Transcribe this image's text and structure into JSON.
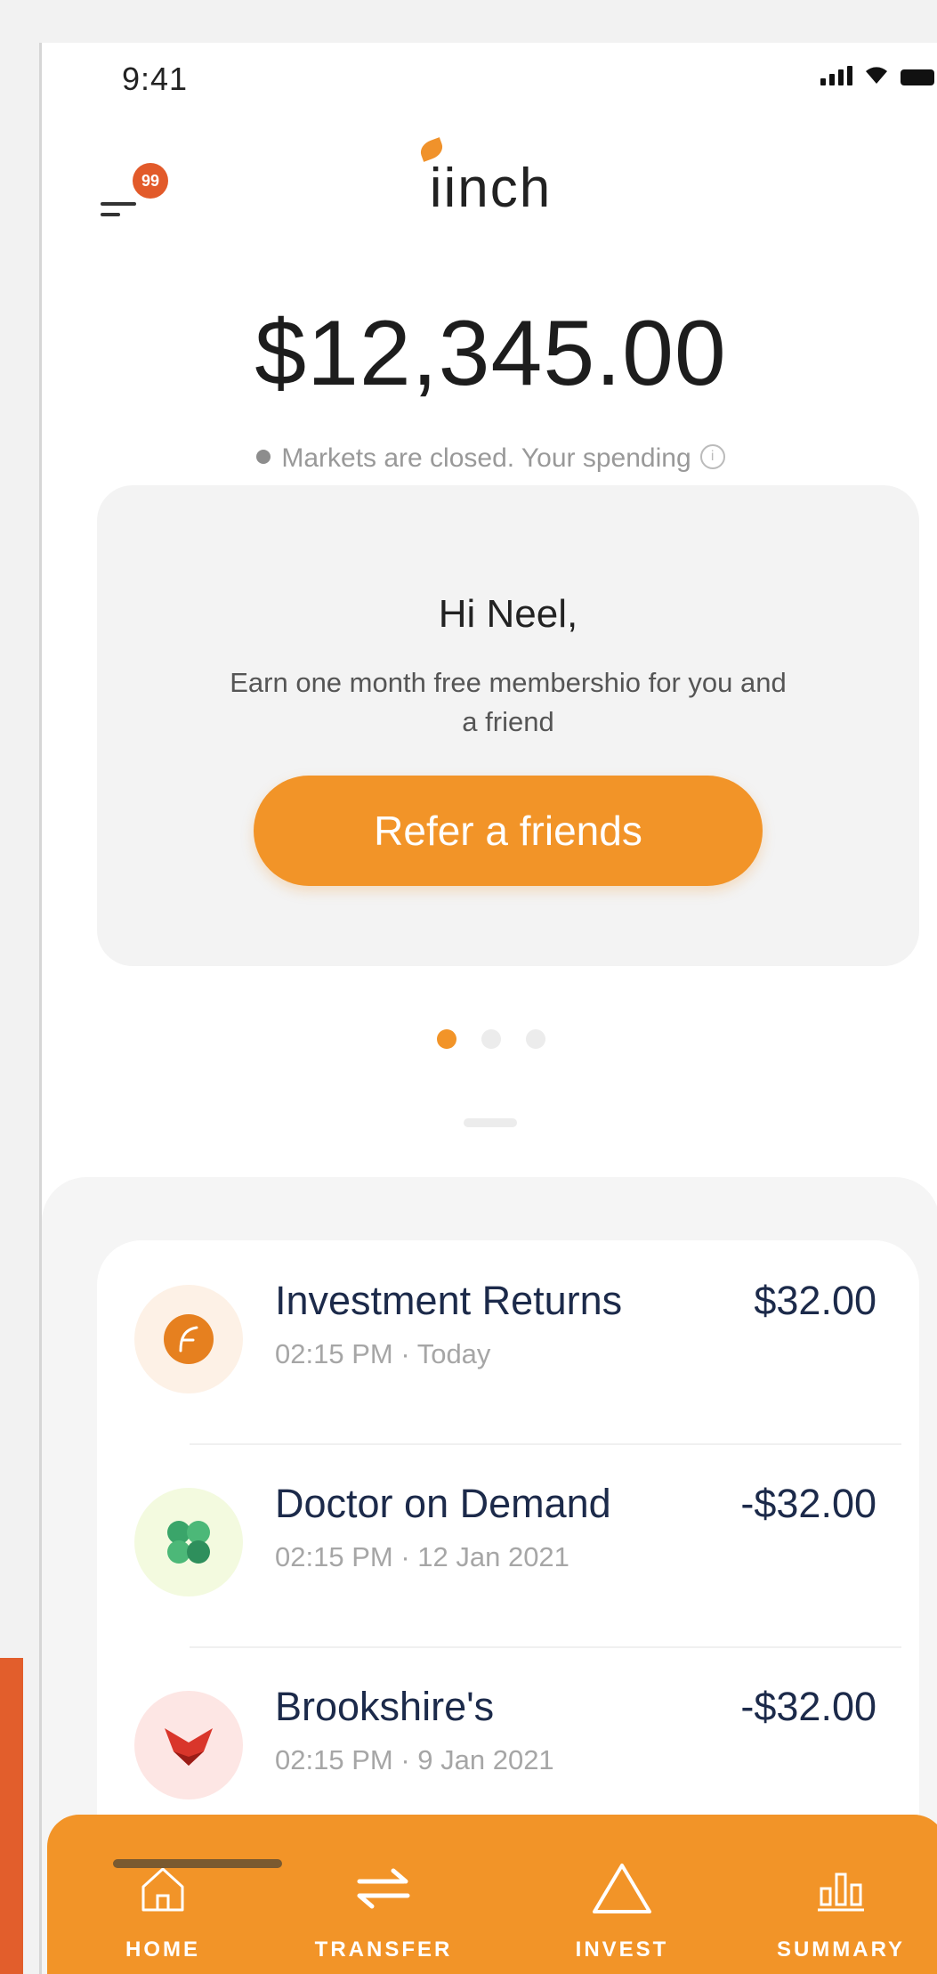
{
  "status_bar": {
    "time": "9:41"
  },
  "header": {
    "menu_badge": "99",
    "app_name": "iinch"
  },
  "balance": {
    "amount": "$12,345.00",
    "market_status": "Markets are closed. Your spending"
  },
  "promo": {
    "greeting": "Hi Neel,",
    "message": "Earn one month free membershio for you and a friend",
    "button_label": "Refer a friends",
    "pages": 3,
    "active_page": 1
  },
  "transactions": [
    {
      "title": "Investment Returns",
      "time": "02:15 PM",
      "date": "Today",
      "amount": "$32.00",
      "icon": "investment-icon",
      "icon_bg": "#fdf1e6",
      "icon_color": "#e6801f"
    },
    {
      "title": "Doctor on Demand",
      "time": "02:15 PM",
      "date": "12 Jan 2021",
      "amount": "-$32.00",
      "icon": "clover-icon",
      "icon_bg": "#f3fadf",
      "icon_color": "#3aa56a"
    },
    {
      "title": "Brookshire's",
      "time": "02:15 PM",
      "date": "9 Jan 2021",
      "amount": "-$32.00",
      "icon": "fox-icon",
      "icon_bg": "#fde6e4",
      "icon_color": "#d9362b"
    }
  ],
  "tabbar": {
    "active": "home",
    "tabs": [
      {
        "label": "HOME",
        "icon": "home-icon"
      },
      {
        "label": "TRANSFER",
        "icon": "transfer-icon"
      },
      {
        "label": "INVEST",
        "icon": "invest-icon"
      },
      {
        "label": "SUMMARY",
        "icon": "summary-icon"
      }
    ]
  },
  "colors": {
    "accent": "#f29428",
    "text_dark": "#1c2a4a",
    "muted": "#a6a6a6"
  }
}
